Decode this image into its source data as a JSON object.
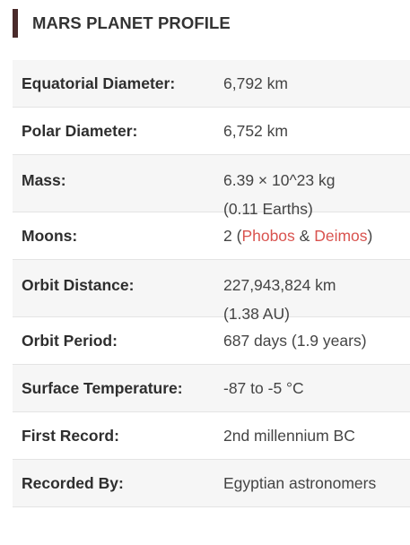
{
  "heading": {
    "title": "MARS PLANET PROFILE"
  },
  "rows": [
    {
      "label": "Equatorial Diameter:",
      "value": "6,792 km"
    },
    {
      "label": "Polar Diameter:",
      "value": "6,752 km"
    },
    {
      "label": "Mass:",
      "value_line1": "6.39 × 10^23 kg",
      "value_line2": "(0.11 Earths)"
    },
    {
      "label": "Moons:",
      "prefix": "2 (",
      "link1": "Phobos",
      "middle": " & ",
      "link2": "Deimos",
      "suffix": ")"
    },
    {
      "label": "Orbit Distance:",
      "value_line1": "227,943,824 km",
      "value_line2": "(1.38 AU)"
    },
    {
      "label": "Orbit Period:",
      "value": "687 days (1.9 years)"
    },
    {
      "label": "Surface Temperature:",
      "value": "-87 to -5 °C"
    },
    {
      "label": "First Record:",
      "value": "2nd millennium BC"
    },
    {
      "label": "Recorded By:",
      "value": "Egyptian astronomers"
    }
  ],
  "colors": {
    "heading_bar": "#4a2b2b",
    "link": "#d9534f",
    "row_stripe": "#f6f6f6"
  }
}
